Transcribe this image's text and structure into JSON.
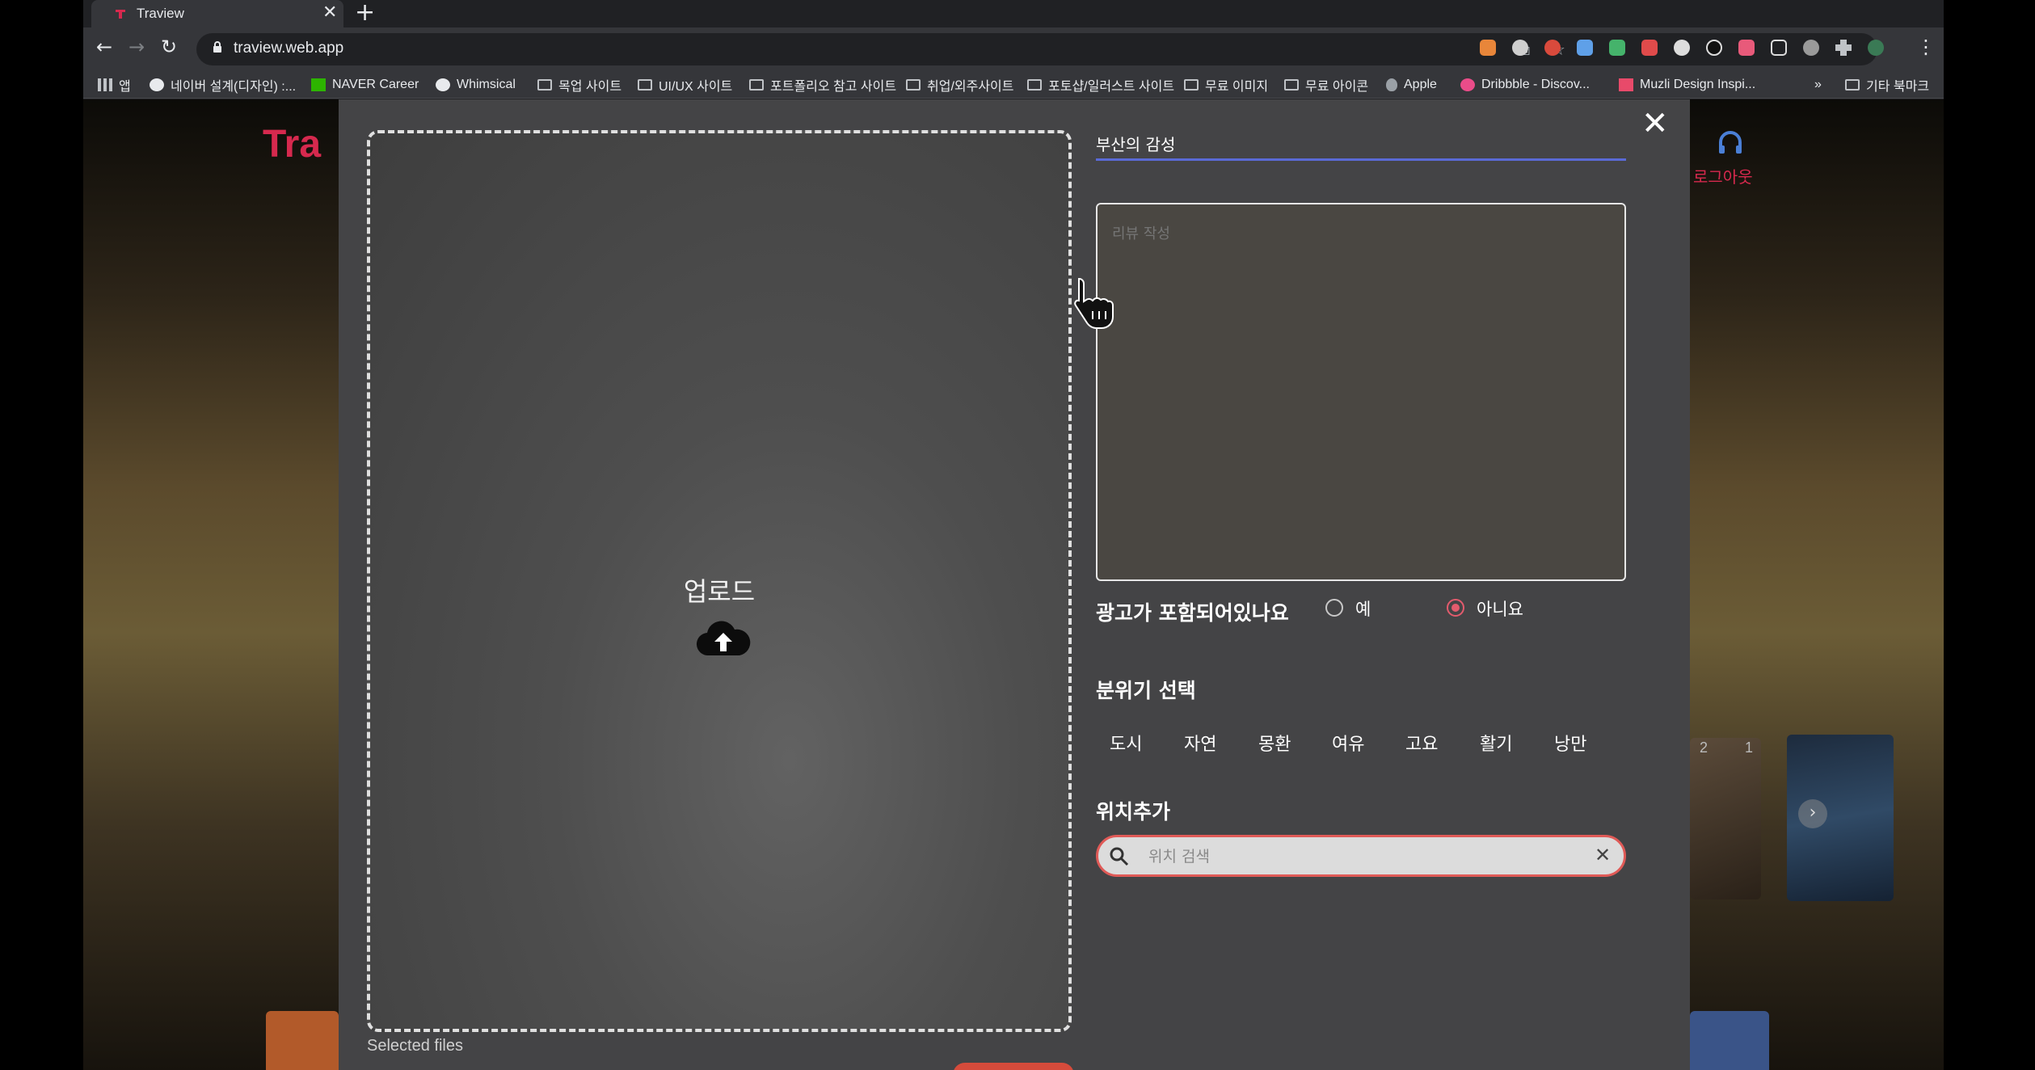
{
  "browser": {
    "tab_title": "Traview",
    "tab_close": "✕",
    "new_tab": "+",
    "url": "traview.web.app",
    "nav": {
      "back": "←",
      "forward": "→",
      "reload": "↻"
    },
    "menu": "⋮",
    "bookmarks_overflow": "»",
    "bookmarks": [
      {
        "label": "앱",
        "icon": "apps-grid-icon"
      },
      {
        "label": "네이버 설계(디자인) :...",
        "icon": "site-icon"
      },
      {
        "label": "NAVER Career",
        "icon": "naver-icon"
      },
      {
        "label": "Whimsical",
        "icon": "site-icon"
      },
      {
        "label": "목업 사이트",
        "icon": "folder-icon"
      },
      {
        "label": "UI/UX 사이트",
        "icon": "folder-icon"
      },
      {
        "label": "포트폴리오 참고 사이트",
        "icon": "folder-icon"
      },
      {
        "label": "취업/외주사이트",
        "icon": "folder-icon"
      },
      {
        "label": "포토샵/일러스트 사이트",
        "icon": "folder-icon"
      },
      {
        "label": "무료 이미지",
        "icon": "folder-icon"
      },
      {
        "label": "무료 아이콘",
        "icon": "folder-icon"
      },
      {
        "label": "Apple",
        "icon": "apple-icon"
      },
      {
        "label": "Dribbble - Discov...",
        "icon": "dribbble-icon"
      },
      {
        "label": "Muzli Design Inspi...",
        "icon": "muzli-icon"
      },
      {
        "label": "기타 북마크",
        "icon": "folder-icon"
      }
    ]
  },
  "page": {
    "logout_label": "로그아웃",
    "thumb_numbers": [
      "2",
      "1"
    ],
    "next_arrow": "›"
  },
  "modal": {
    "close": "✕",
    "upload_title": "업로드",
    "selected_files": "Selected files",
    "title_value": "부산의 감성",
    "review_placeholder": "리뷰 작성",
    "ad_question": "광고가 포함되어있나요",
    "ad_options": [
      {
        "label": "예",
        "checked": false
      },
      {
        "label": "아니요",
        "checked": true
      }
    ],
    "mood_label": "분위기 선택",
    "moods": [
      "도시",
      "자연",
      "몽환",
      "여유",
      "고요",
      "활기",
      "낭만"
    ],
    "location_label": "위치추가",
    "location_placeholder": "위치 검색",
    "clear": "✕"
  },
  "colors": {
    "accent_underline": "#5a6ad6",
    "brand_red": "#d6294e",
    "radio_selected": "#e35b6d",
    "search_border": "#e05a57"
  }
}
